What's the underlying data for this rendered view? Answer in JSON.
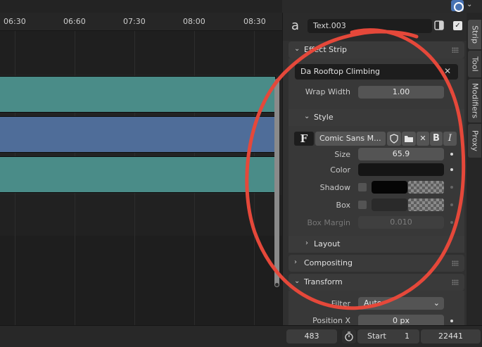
{
  "topbar": {
    "overlay_icon": "overlay-icon",
    "chevron": "⌄"
  },
  "timeline": {
    "ruler_labels": [
      "06:30",
      "06:60",
      "07:30",
      "08:00",
      "08:30"
    ]
  },
  "sidebar": {
    "strip_type_icon": "a",
    "strip_name": "Text.003",
    "effect_strip": {
      "title": "Effect Strip",
      "text_value": "Da Rooftop Climbing",
      "wrap_width_label": "Wrap Width",
      "wrap_width_value": "1.00",
      "style": {
        "title": "Style",
        "font_icon": "F",
        "font_name": "Comic Sans M...",
        "size_label": "Size",
        "size_value": "65.9",
        "color_label": "Color",
        "color_value": "#151515",
        "shadow_label": "Shadow",
        "shadow_color": "#050505",
        "box_label": "Box",
        "box_color": "#2a2a2a",
        "box_margin_label": "Box Margin",
        "box_margin_value": "0.010"
      },
      "layout_title": "Layout"
    },
    "compositing_title": "Compositing",
    "transform": {
      "title": "Transform",
      "filter_label": "Filter",
      "filter_value": "Auto",
      "position_x_label": "Position X",
      "position_x_value": "0 px"
    }
  },
  "tabs": [
    "Strip",
    "Tool",
    "Modifiers",
    "Proxy"
  ],
  "bottombar": {
    "current_frame": "483",
    "start_label": "Start",
    "start_value": "1",
    "end_value": "22441"
  },
  "colors": {
    "strip_teal": "#4a8c88",
    "strip_blue": "#4f6d99",
    "annotation": "#e5483a",
    "accent_blue": "#4772b3"
  }
}
